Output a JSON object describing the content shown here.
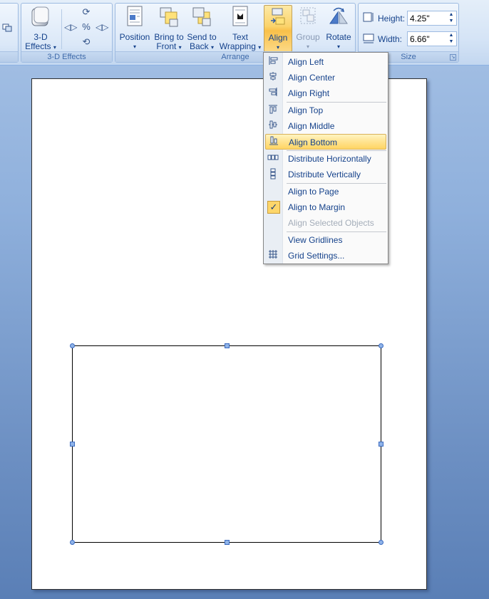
{
  "ribbon": {
    "groups": {
      "three_d": {
        "label": "3-D Effects",
        "button_label_1": "3-D",
        "button_label_2": "Effects"
      },
      "arrange": {
        "label": "Arrange",
        "position_label": "Position",
        "bring_front_1": "Bring to",
        "bring_front_2": "Front",
        "send_back_1": "Send to",
        "send_back_2": "Back",
        "text_wrap_1": "Text",
        "text_wrap_2": "Wrapping",
        "align_label": "Align",
        "group_label": "Group",
        "rotate_label": "Rotate"
      },
      "size": {
        "label": "Size",
        "height_label": "Height:",
        "height_value": "4.25\"",
        "width_label": "Width:",
        "width_value": "6.66\""
      }
    }
  },
  "align_menu": {
    "items": [
      {
        "icon": "align-left-icon",
        "label": "Align Left",
        "state": "normal"
      },
      {
        "icon": "align-center-icon",
        "label": "Align Center",
        "state": "normal"
      },
      {
        "icon": "align-right-icon",
        "label": "Align Right",
        "state": "normal"
      },
      {
        "icon": "align-top-icon",
        "label": "Align Top",
        "state": "normal"
      },
      {
        "icon": "align-middle-icon",
        "label": "Align Middle",
        "state": "normal"
      },
      {
        "icon": "align-bottom-icon",
        "label": "Align Bottom",
        "state": "highlighted"
      },
      {
        "icon": "distribute-horizontally-icon",
        "label": "Distribute Horizontally",
        "state": "normal"
      },
      {
        "icon": "distribute-vertically-icon",
        "label": "Distribute Vertically",
        "state": "normal"
      },
      {
        "icon": "",
        "label": "Align to Page",
        "state": "normal"
      },
      {
        "icon": "checkmark-icon",
        "label": "Align to Margin",
        "state": "checked"
      },
      {
        "icon": "",
        "label": "Align Selected Objects",
        "state": "disabled"
      },
      {
        "icon": "",
        "label": "View Gridlines",
        "state": "normal"
      },
      {
        "icon": "grid-settings-icon",
        "label": "Grid Settings...",
        "state": "normal"
      }
    ]
  },
  "colors": {
    "accent_highlight": "#ffd563",
    "ribbon_text": "#15428b",
    "workspace": "#6d90c3"
  }
}
